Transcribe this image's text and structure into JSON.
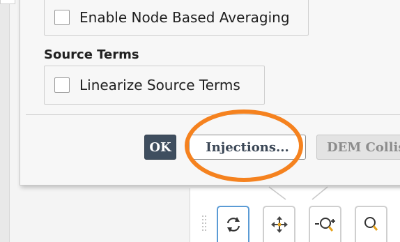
{
  "dialog": {
    "node_averaging_label": "Enable Node Based Averaging",
    "source_terms_title": "Source Terms",
    "linearize_label": "Linearize Source Terms",
    "node_averaging_checked": false,
    "linearize_checked": false
  },
  "buttons": {
    "ok_label": "OK",
    "injections_label": "Injections...",
    "dem_label": "DEM Collis"
  },
  "toolbar": {
    "icons": [
      "rotate-icon",
      "pan-icon",
      "zoom-in-out-icon",
      "zoom-icon"
    ]
  },
  "annotation": {
    "color": "#f5821f"
  },
  "colors": {
    "ok_button": "#3f4e5f",
    "dialog_bg": "#f7f7f7"
  }
}
